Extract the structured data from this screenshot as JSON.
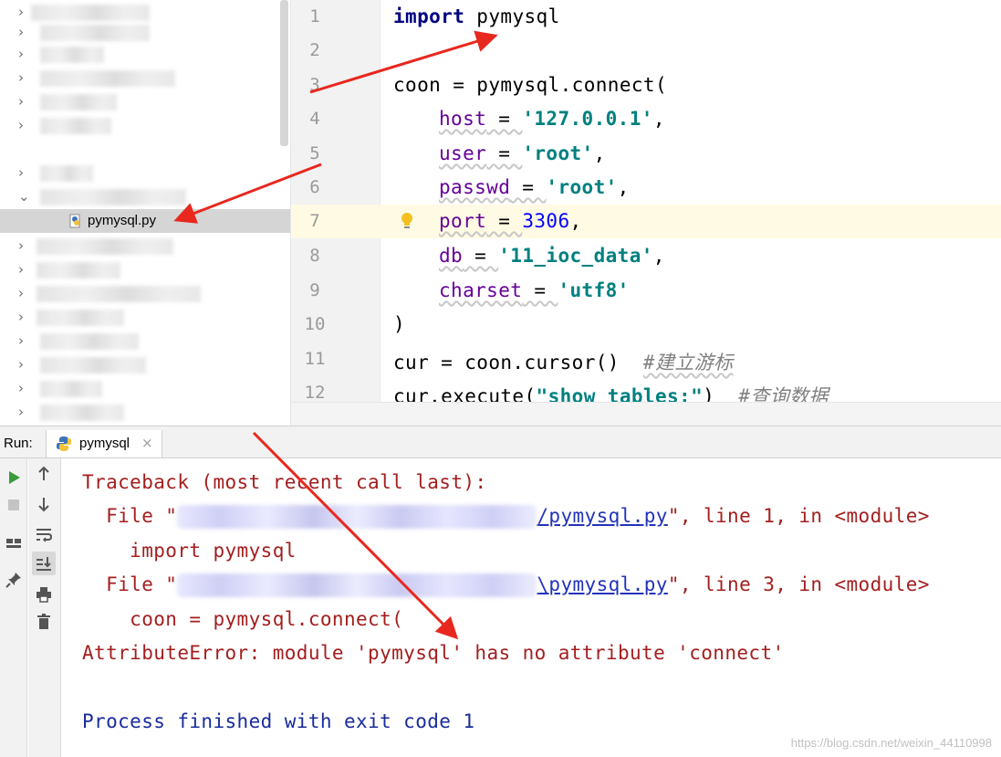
{
  "project_tree": {
    "selected_file": "pymysql.py",
    "rows": [
      {
        "arrow": "›"
      },
      {
        "arrow": "›"
      },
      {
        "arrow": "›"
      },
      {
        "arrow": "›"
      },
      {
        "arrow": "›"
      },
      {
        "arrow": "›"
      },
      {
        "arrow": "›"
      },
      {
        "arrow": "⌄"
      },
      {
        "file": "pymysql.py"
      },
      {
        "arrow": "›"
      },
      {
        "arrow": "›"
      },
      {
        "arrow": "›"
      },
      {
        "arrow": "›"
      },
      {
        "arrow": "›"
      },
      {
        "arrow": "›"
      },
      {
        "arrow": "›"
      },
      {
        "arrow": "›"
      }
    ]
  },
  "editor": {
    "current_line": 7,
    "line_numbers": [
      "1",
      "2",
      "3",
      "4",
      "5",
      "6",
      "7",
      "8",
      "9",
      "10",
      "11",
      "12"
    ],
    "l1": {
      "kw": "import",
      "rest": " pymysql"
    },
    "l3": "coon = pymysql.connect(",
    "l4": {
      "p": "host",
      "eq": " = ",
      "s": "'127.0.0.1'",
      "end": ","
    },
    "l5": {
      "p": "user",
      "eq": " = ",
      "s": "'root'",
      "end": ","
    },
    "l6": {
      "p": "passwd",
      "eq": " = ",
      "s": "'root'",
      "end": ","
    },
    "l7": {
      "p": "port",
      "eq": " = ",
      "n": "3306",
      "end": ","
    },
    "l8": {
      "p": "db",
      "eq": " = ",
      "s": "'11_ioc_data'",
      "end": ","
    },
    "l9": {
      "p": "charset",
      "eq": " = ",
      "s": "'utf8'"
    },
    "l10": ")",
    "l11": {
      "code": "cur = coon.cursor()  ",
      "c": "#建立游标"
    },
    "l12": {
      "code1": "cur.execute(",
      "s": "\"show tables;\"",
      "code2": ")  ",
      "c": "#查询数据"
    }
  },
  "run_panel": {
    "label": "Run:",
    "tab_label": "pymysql",
    "tab_close": "×"
  },
  "console": {
    "l1": "Traceback (most recent call last):",
    "l2": {
      "pre": "  File \"",
      "link": "/pymysql.py",
      "post": "\", line 1, in <module>"
    },
    "l3": "    import pymysql",
    "l4": {
      "pre": "  File \"",
      "link": "\\pymysql.py",
      "post": "\", line 3, in <module>"
    },
    "l5": "    coon = pymysql.connect(",
    "l6": "AttributeError: module 'pymysql' has no attribute 'connect'",
    "l7": "Process finished with exit code 1"
  },
  "watermark": "https://blog.csdn.net/weixin_44110998",
  "icons": {
    "rerun": "play-icon",
    "stop": "stop-icon",
    "up": "arrow-up-icon",
    "down": "arrow-down-icon",
    "wrap": "soft-wrap-icon",
    "scroll_end": "scroll-to-end-icon",
    "print": "print-icon",
    "trash": "trash-icon",
    "layout": "layout-icon",
    "pin": "pin-icon",
    "bulb": "lightbulb-icon"
  },
  "colors": {
    "annotation_arrow": "#e8281e",
    "current_line": "#fffae3",
    "error_text": "#a41e1e"
  }
}
